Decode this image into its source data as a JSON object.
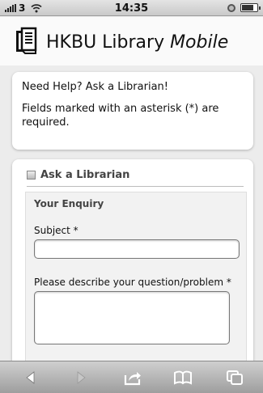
{
  "status_bar": {
    "carrier": "3",
    "time": "14:35"
  },
  "header": {
    "title_main": "HKBU Library ",
    "title_italic": "Mobile",
    "logo": "library-book-logo-icon"
  },
  "help_card": {
    "heading": "Need Help? Ask a Librarian!",
    "note": "Fields marked with an asterisk (*) are required."
  },
  "form": {
    "legend": "Ask a Librarian",
    "section_title": "Your Enquiry",
    "subject_label": "Subject *",
    "subject_value": "",
    "description_label": "Please describe your question/problem *",
    "description_value": ""
  },
  "toolbar": {
    "icons": [
      "back-arrow-icon",
      "forward-arrow-icon",
      "share-icon",
      "bookmarks-icon",
      "tabs-icon"
    ]
  },
  "colors": {
    "background": "#ececec",
    "card": "#ffffff",
    "panel": "#f2f2f2",
    "toolbar_top": "#cfcfcf",
    "toolbar_bottom": "#9e9e9e"
  }
}
